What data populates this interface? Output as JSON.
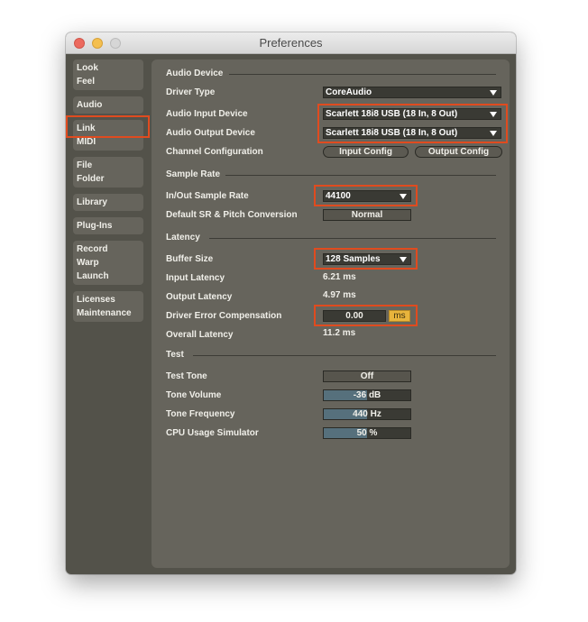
{
  "window": {
    "title": "Preferences",
    "traffic_lights": [
      "close",
      "minimize",
      "maximize"
    ]
  },
  "sidebar": {
    "items": [
      {
        "lines": [
          "Look",
          "Feel"
        ]
      },
      {
        "lines": [
          "Audio"
        ],
        "selected": true
      },
      {
        "lines": [
          "Link",
          "MIDI"
        ]
      },
      {
        "lines": [
          "File",
          "Folder"
        ]
      },
      {
        "lines": [
          "Library"
        ]
      },
      {
        "lines": [
          "Plug-Ins"
        ]
      },
      {
        "lines": [
          "Record",
          "Warp",
          "Launch"
        ]
      },
      {
        "lines": [
          "Licenses",
          "Maintenance"
        ]
      }
    ]
  },
  "audio_device": {
    "section_title": "Audio Device",
    "driver_type_label": "Driver Type",
    "driver_type_value": "CoreAudio",
    "input_device_label": "Audio Input Device",
    "input_device_value": "Scarlett 18i8 USB (18 In, 8 Out)",
    "output_device_label": "Audio Output Device",
    "output_device_value": "Scarlett 18i8 USB (18 In, 8 Out)",
    "channel_config_label": "Channel Configuration",
    "input_config_button": "Input Config",
    "output_config_button": "Output Config"
  },
  "sample_rate": {
    "section_title": "Sample Rate",
    "rate_label": "In/Out Sample Rate",
    "rate_value": "44100",
    "conversion_label": "Default SR & Pitch Conversion",
    "conversion_value": "Normal"
  },
  "latency": {
    "section_title": "Latency",
    "buffer_label": "Buffer Size",
    "buffer_value": "128 Samples",
    "input_latency_label": "Input Latency",
    "input_latency_value": "6.21 ms",
    "output_latency_label": "Output Latency",
    "output_latency_value": "4.97 ms",
    "driver_comp_label": "Driver Error Compensation",
    "driver_comp_value": "0.00",
    "driver_comp_unit": "ms",
    "overall_label": "Overall Latency",
    "overall_value": "11.2 ms"
  },
  "test": {
    "section_title": "Test",
    "tone_label": "Test Tone",
    "tone_value": "Off",
    "volume_label": "Tone Volume",
    "volume_value": "-36 dB",
    "volume_fill_fraction": 0.5,
    "frequency_label": "Tone Frequency",
    "frequency_value": "440 Hz",
    "frequency_fill_fraction": 0.5,
    "cpu_label": "CPU Usage Simulator",
    "cpu_value": "50 %",
    "cpu_fill_fraction": 0.5
  },
  "colors": {
    "highlight": "#e04b1f",
    "unit_button": "#e8b43c",
    "slider_fill": "#56707c"
  }
}
